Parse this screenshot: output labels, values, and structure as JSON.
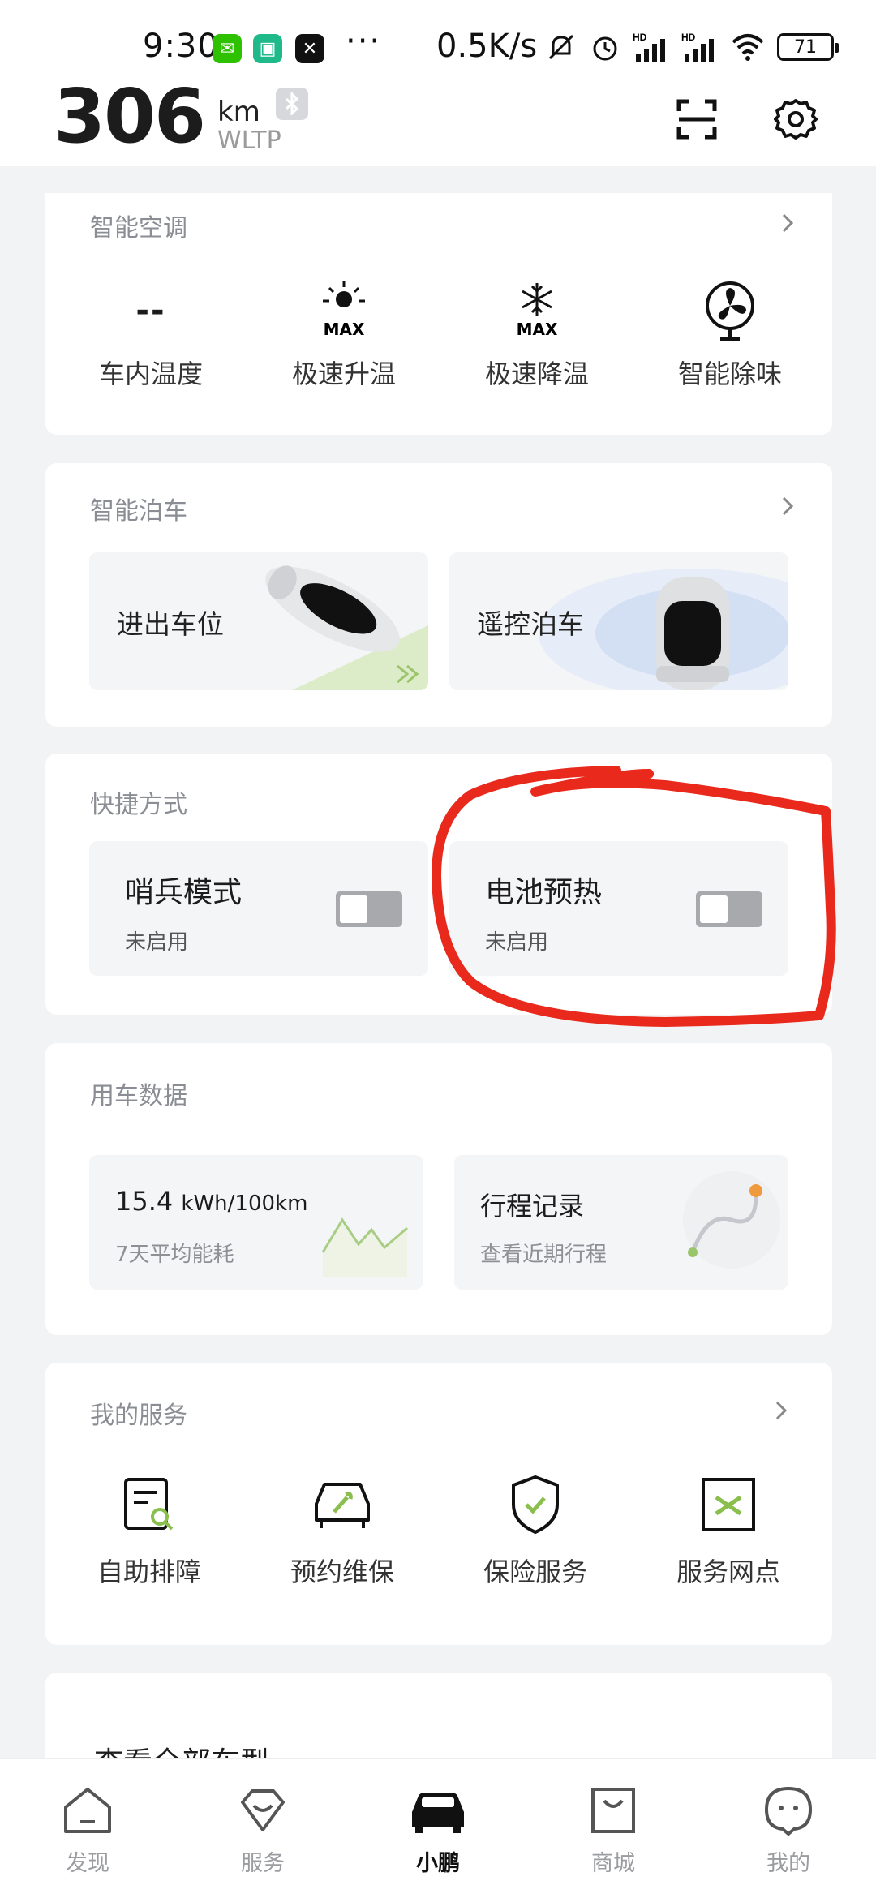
{
  "status_bar": {
    "time": "9:30",
    "dots": "···",
    "net_speed": "0.5K/s",
    "battery": "71"
  },
  "header": {
    "range_value": "306",
    "range_unit": "km",
    "range_standard": "WLTP"
  },
  "climate": {
    "title": "智能空调",
    "items": [
      {
        "label": "车内温度",
        "value": "--",
        "icon": "temperature-icon"
      },
      {
        "label": "极速升温",
        "icon": "sun-max-icon"
      },
      {
        "label": "极速降温",
        "icon": "snowflake-max-icon"
      },
      {
        "label": "智能除味",
        "icon": "fan-icon"
      }
    ],
    "max_text": "MAX"
  },
  "parking": {
    "title": "智能泊车",
    "tiles": [
      {
        "label": "进出车位"
      },
      {
        "label": "遥控泊车"
      }
    ]
  },
  "shortcuts": {
    "title": "快捷方式",
    "tiles": [
      {
        "title": "哨兵模式",
        "status": "未启用",
        "enabled": false
      },
      {
        "title": "电池预热",
        "status": "未启用",
        "enabled": false
      }
    ]
  },
  "usage": {
    "title": "用车数据",
    "energy_value": "15.4",
    "energy_unit": "kWh/100km",
    "energy_desc": "7天平均能耗",
    "trip_title": "行程记录",
    "trip_desc": "查看近期行程"
  },
  "services": {
    "title": "我的服务",
    "items": [
      {
        "label": "自助排障",
        "icon": "diagnosis-icon"
      },
      {
        "label": "预约维保",
        "icon": "car-repair-icon"
      },
      {
        "label": "保险服务",
        "icon": "shield-check-icon"
      },
      {
        "label": "服务网点",
        "icon": "service-point-icon"
      }
    ]
  },
  "partial_card": {
    "title": "查看全部车型"
  },
  "tabbar": {
    "tabs": [
      {
        "label": "发现",
        "icon": "home-icon"
      },
      {
        "label": "服务",
        "icon": "heart-service-icon"
      },
      {
        "label": "小鹏",
        "icon": "car-icon",
        "active": true
      },
      {
        "label": "商城",
        "icon": "shopping-bag-icon"
      },
      {
        "label": "我的",
        "icon": "profile-face-icon"
      }
    ]
  },
  "colors": {
    "accent_annotation": "#e8291c",
    "background": "#f2f3f5",
    "card": "#ffffff",
    "toggle_off": "#a7a9ad"
  }
}
